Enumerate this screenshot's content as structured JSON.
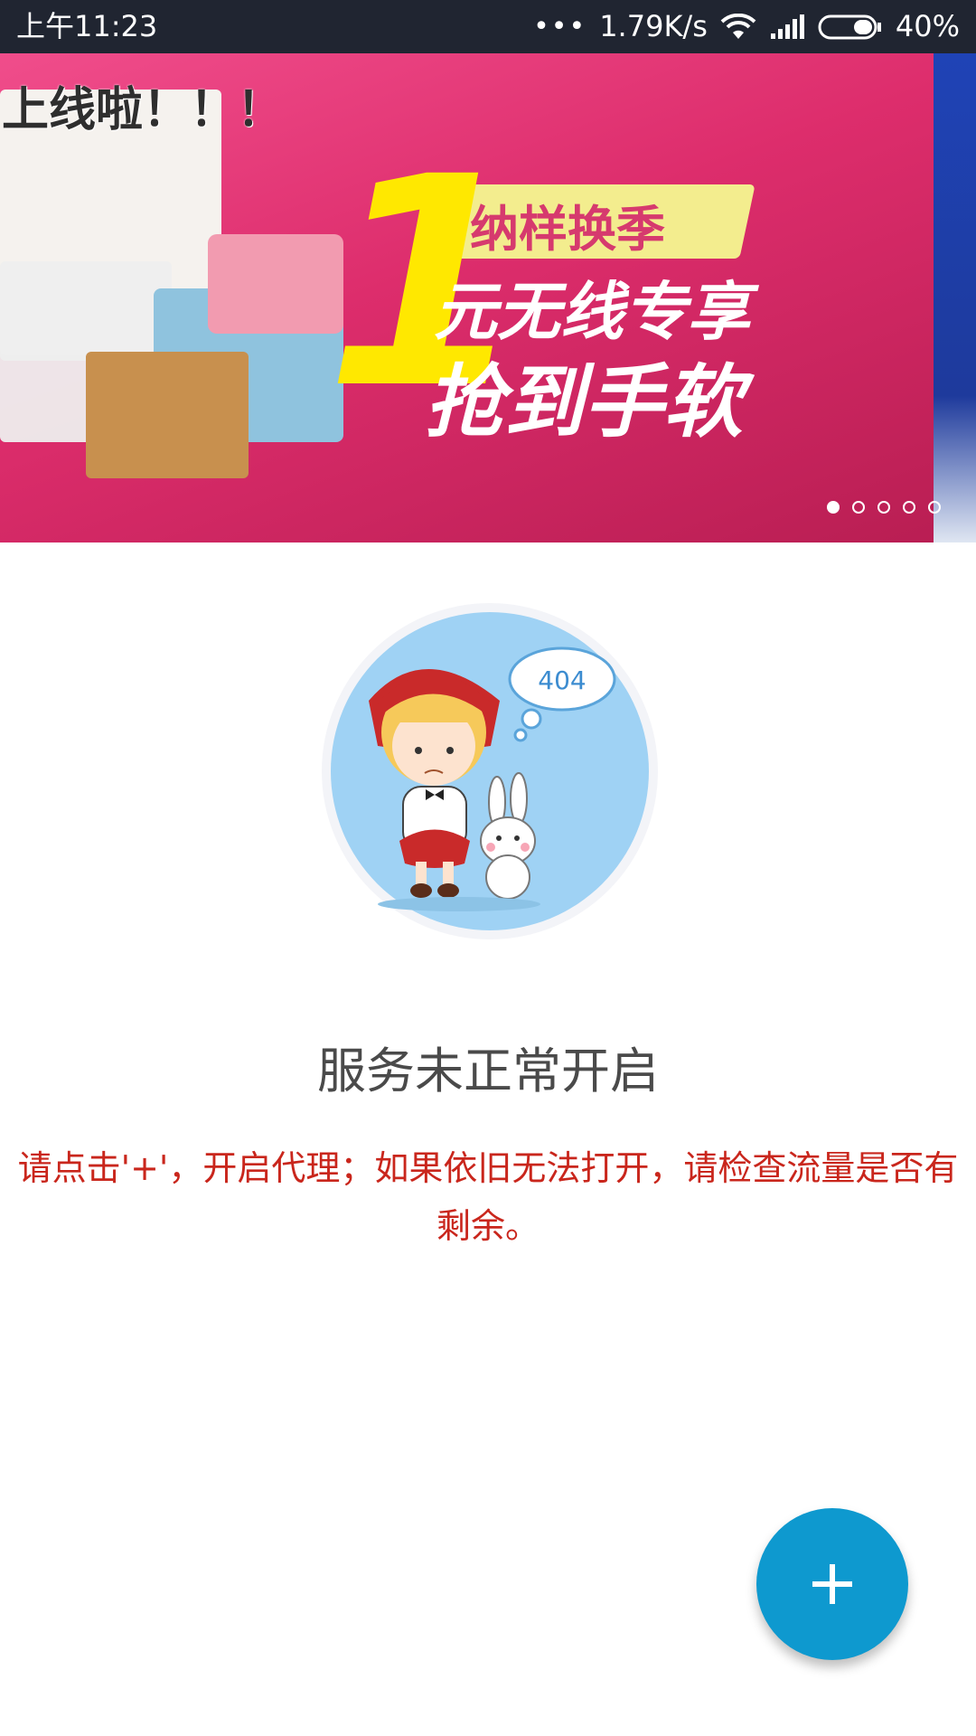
{
  "status_bar": {
    "time": "上午11:23",
    "network_speed": "1.79K/s",
    "battery": "40%"
  },
  "banner": {
    "caption": "上线啦！！！",
    "promo_tag": "纳样换季",
    "promo_number": "1",
    "promo_line1": "元无线专享",
    "promo_line2": "抢到手软",
    "page_count": 5,
    "active_index": 0
  },
  "illustration": {
    "bubble_text": "404"
  },
  "error": {
    "title": "服务未正常开启",
    "hint": "请点击'+'，开启代理；如果依旧无法打开，请检查流量是否有剩余。"
  },
  "fab": {
    "icon": "plus-icon",
    "color": "#0e99cf"
  }
}
